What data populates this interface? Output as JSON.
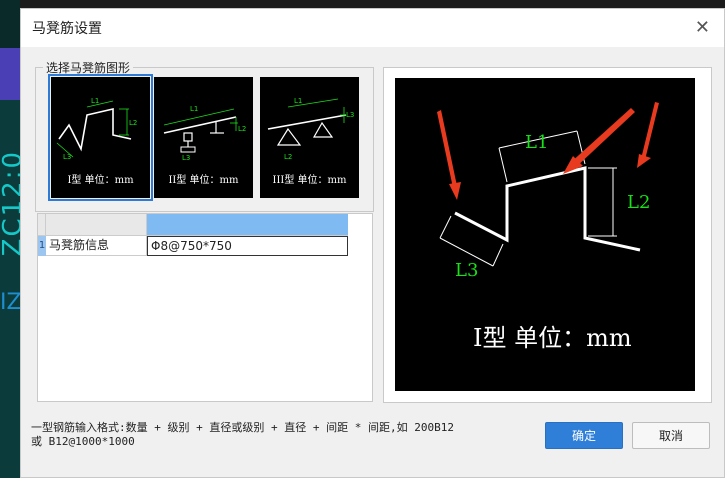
{
  "background": {
    "cad_text": "ZC12:0",
    "cad_text2": "IZ"
  },
  "dialog": {
    "title": "马凳筋设置",
    "close_glyph": "✕"
  },
  "shape_group": {
    "label": "选择马凳筋图形",
    "shapes": [
      {
        "caption": "I型 单位：mm",
        "selected": true
      },
      {
        "caption": "II型 单位：mm",
        "selected": false
      },
      {
        "caption": "III型 单位：mm",
        "selected": false
      }
    ],
    "dim_labels": {
      "l1": "L1",
      "l2": "L2",
      "l3": "L3"
    }
  },
  "grid": {
    "rows": [
      {
        "num": "1",
        "label": "马凳筋信息",
        "value": "Φ8@750*750"
      }
    ]
  },
  "preview": {
    "caption": "I型 单位：mm",
    "labels": {
      "l1": "L1",
      "l2": "L2",
      "l3": "L3"
    },
    "colors": {
      "dim": "#19e019",
      "arrow": "#e83a1e",
      "rebar": "#ffffff"
    }
  },
  "hint": {
    "line1": "一型钢筋输入格式:数量 + 级别 + 直径或级别 + 直径 + 间距 * 间距,如 200B12",
    "line2": "或 B12@1000*1000"
  },
  "buttons": {
    "ok": "确定",
    "cancel": "取消"
  }
}
